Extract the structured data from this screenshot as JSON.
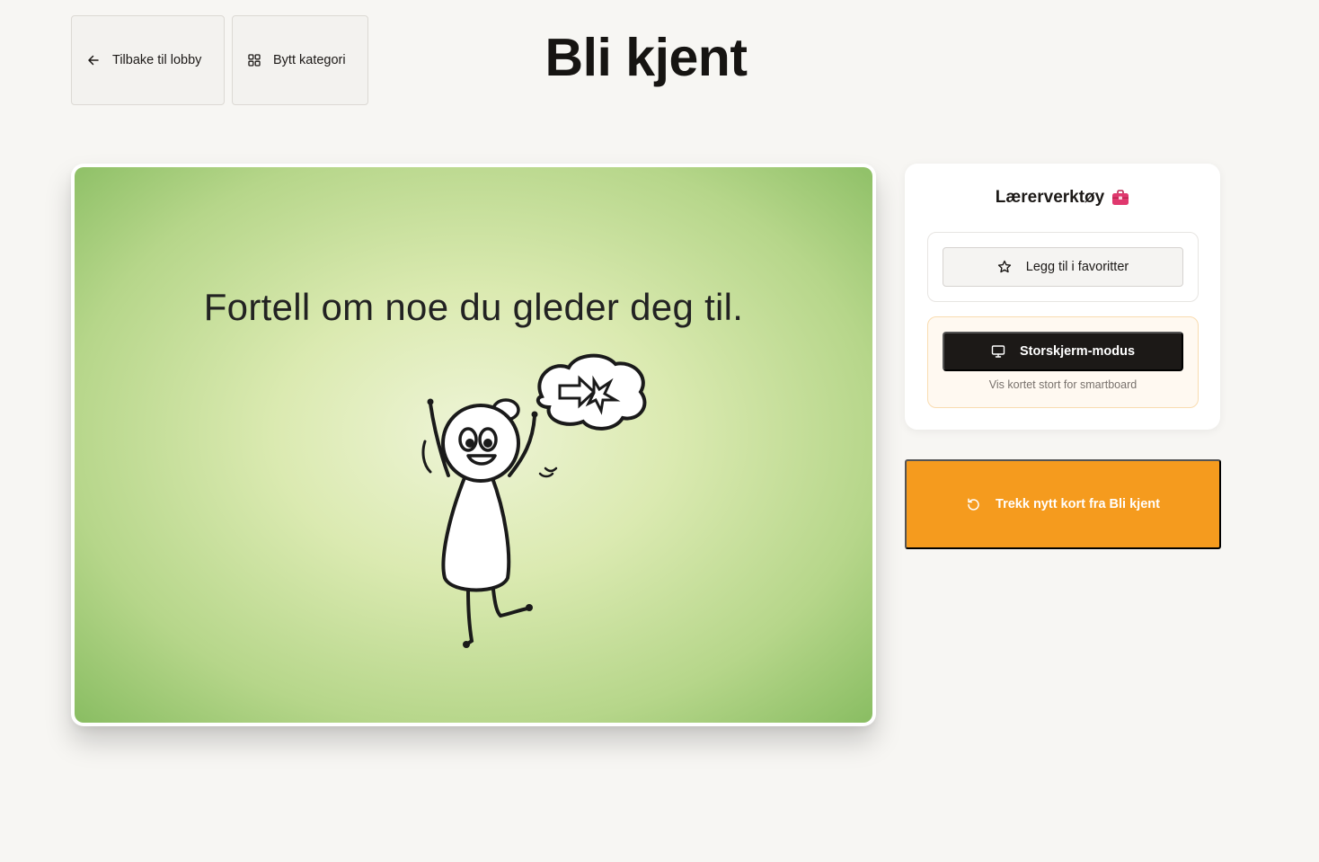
{
  "header": {
    "back_label": "Tilbake til lobby",
    "category_label": "Bytt kategori",
    "title": "Bli kjent"
  },
  "card": {
    "question": "Fortell om noe du gleder deg til."
  },
  "tools": {
    "title": "Lærerverktøy",
    "favorite_label": "Legg til i favoritter",
    "bigscreen_label": "Storskjerm-modus",
    "bigscreen_subtitle": "Vis kortet stort for smartboard"
  },
  "draw": {
    "label": "Trekk nytt kort fra Bli kjent"
  },
  "colors": {
    "background": "#f7f6f3",
    "accent_orange": "#f59b1e",
    "dark_button": "#1c1917",
    "card_green": "#89bd62",
    "toolbox_pink": "#e0386e"
  },
  "icons": [
    "arrow-left-icon",
    "grid-icon",
    "toolbox-icon",
    "star-icon",
    "monitor-icon",
    "refresh-icon"
  ]
}
